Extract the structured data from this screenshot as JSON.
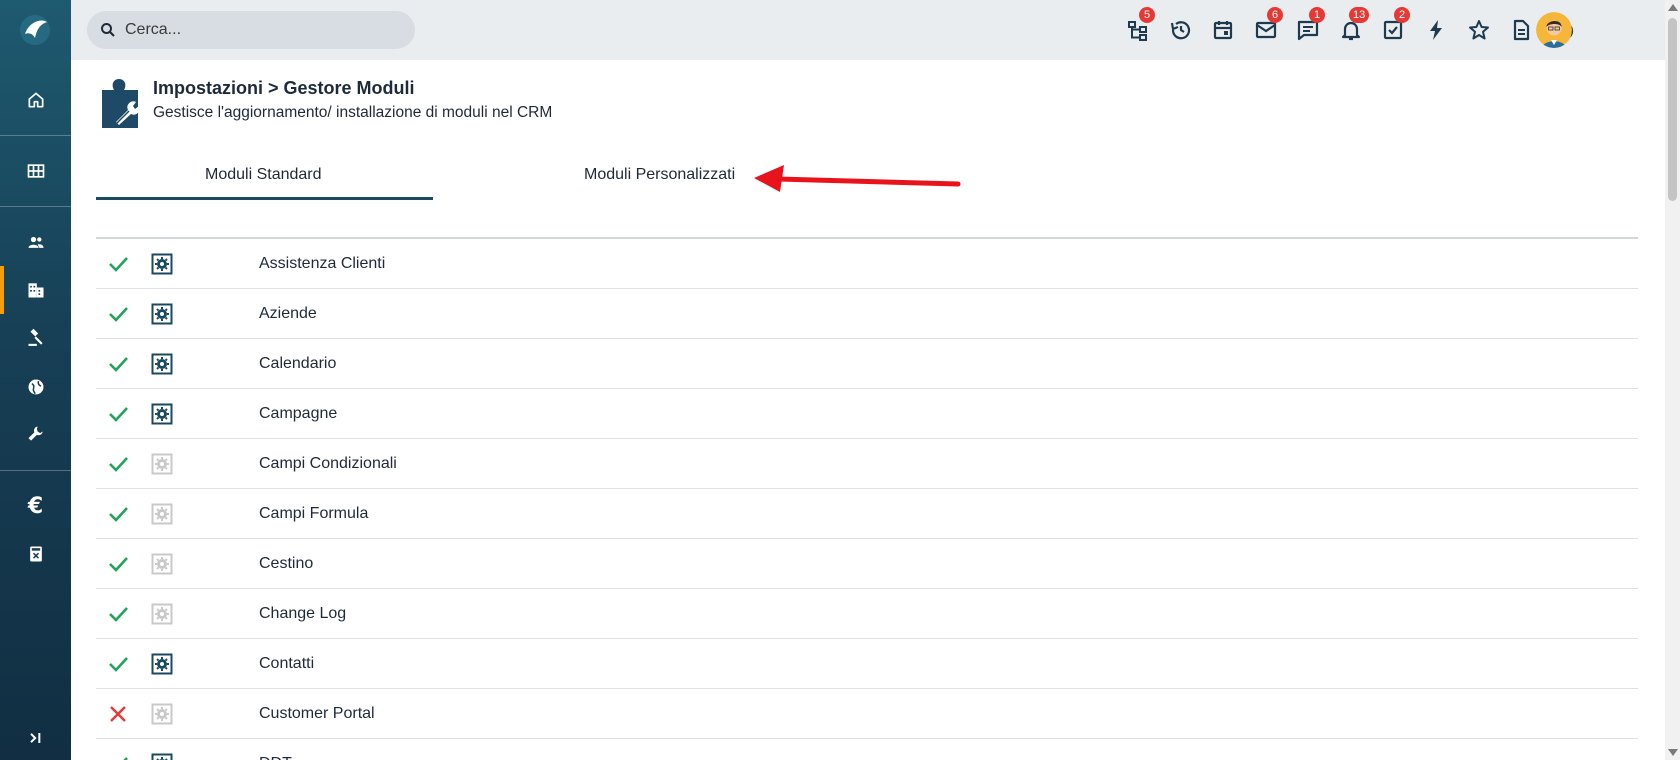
{
  "search": {
    "placeholder": "Cerca..."
  },
  "header": {
    "title": "Impostazioni > Gestore Moduli",
    "subtitle": "Gestisce l'aggiornamento/ installazione di moduli nel CRM"
  },
  "tabs": [
    {
      "label": "Moduli Standard",
      "active": true
    },
    {
      "label": "Moduli Personalizzati",
      "active": false
    }
  ],
  "topbar": {
    "badges": {
      "hierarchy": "5",
      "mail": "6",
      "chat": "1",
      "notifications": "13",
      "tasks": "2"
    }
  },
  "sidebar": {
    "euro_symbol": "€"
  },
  "colors": {
    "accent": "#f59e0b",
    "badge": "#e53935",
    "check": "#22a35a",
    "cross": "#e53935",
    "active_config": "#1a4a60",
    "inactive_config": "#c9c9c9"
  },
  "modules": [
    {
      "name": "Assistenza Clienti",
      "enabled": true,
      "configurable": true
    },
    {
      "name": "Aziende",
      "enabled": true,
      "configurable": true
    },
    {
      "name": "Calendario",
      "enabled": true,
      "configurable": true
    },
    {
      "name": "Campagne",
      "enabled": true,
      "configurable": true
    },
    {
      "name": "Campi Condizionali",
      "enabled": true,
      "configurable": false
    },
    {
      "name": "Campi Formula",
      "enabled": true,
      "configurable": false
    },
    {
      "name": "Cestino",
      "enabled": true,
      "configurable": false
    },
    {
      "name": "Change Log",
      "enabled": true,
      "configurable": false
    },
    {
      "name": "Contatti",
      "enabled": true,
      "configurable": true
    },
    {
      "name": "Customer Portal",
      "enabled": false,
      "configurable": false
    },
    {
      "name": "DDT",
      "enabled": true,
      "configurable": true
    }
  ]
}
